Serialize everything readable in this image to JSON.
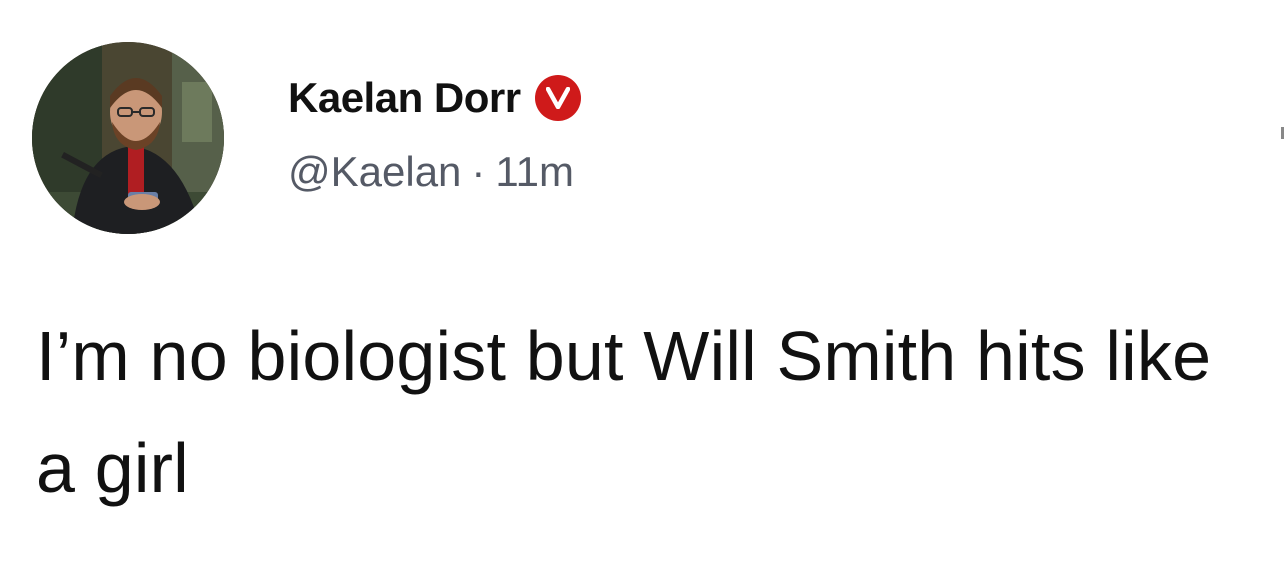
{
  "post": {
    "author": {
      "display_name": "Kaelan Dorr",
      "verified_badge_glyph": "V",
      "handle": "@Kaelan",
      "separator": "·",
      "timestamp": "11m"
    },
    "text": "I’m no biologist but Will Smith hits like a girl",
    "avatar_icon": "profile-photo-icon"
  },
  "colors": {
    "badge": "#cf1a1a",
    "text": "#111111",
    "meta": "#555a66",
    "background": "#ffffff"
  }
}
